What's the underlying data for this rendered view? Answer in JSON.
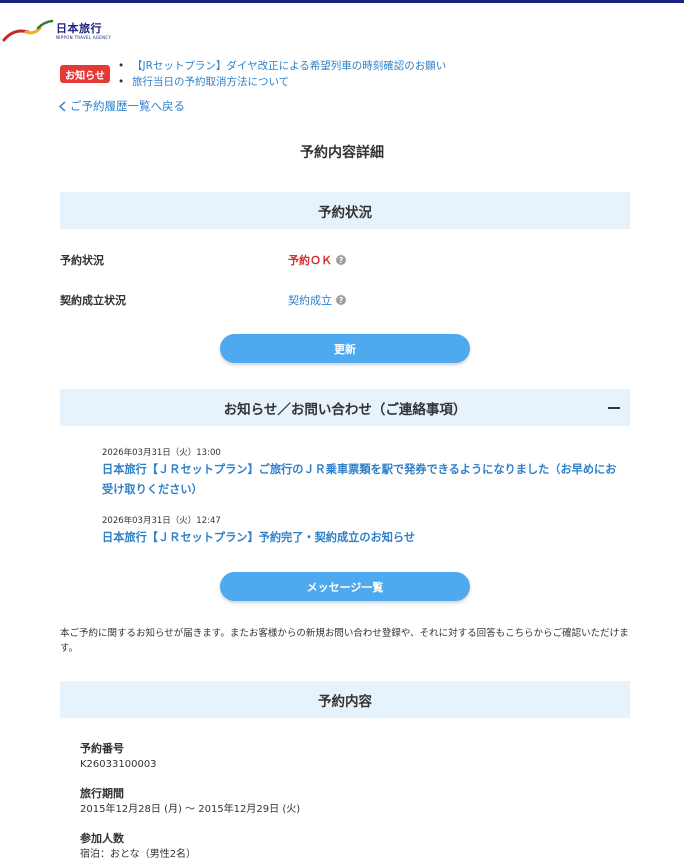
{
  "brand": {
    "name": "日本旅行",
    "sub": "NIPPON TRAVEL AGENCY",
    "colors": {
      "navy": "#1a237e",
      "red": "#c62828",
      "yellow": "#f9a825",
      "green": "#2e7d32"
    }
  },
  "notice": {
    "badge": "お知らせ",
    "items": [
      "【JRセットプラン】ダイヤ改正による希望列車の時刻確認のお願い",
      "旅行当日の予約取消方法について"
    ]
  },
  "nav": {
    "back_icon": "chevron-left-icon",
    "back_label": "ご予約履歴一覧へ戻る"
  },
  "page": {
    "title": "予約内容詳細"
  },
  "status_section": {
    "title": "予約状況",
    "rows": [
      {
        "label": "予約状況",
        "value": "予約ＯＫ",
        "help": "?"
      },
      {
        "label": "契約成立状況",
        "value": "契約成立",
        "help": "?"
      }
    ],
    "refresh_button": "更新"
  },
  "messages_section": {
    "title": "お知らせ／お問い合わせ（ご連絡事項）",
    "messages": [
      {
        "date": "2026年03月31日（火）13:00",
        "title": "日本旅行【ＪＲセットプラン】ご旅行のＪＲ乗車票類を駅で発券できるようになりました（お早めにお受け取りください）"
      },
      {
        "date": "2026年03月31日（火）12:47",
        "title": "日本旅行【ＪＲセットプラン】予約完了・契約成立のお知らせ"
      }
    ],
    "list_button": "メッセージ一覧",
    "description": "本ご予約に関するお知らせが届きます。またお客様からの新規お問い合わせ登録や、それに対する回答もこちらからご確認いただけます。"
  },
  "booking_section": {
    "title": "予約内容",
    "fields": [
      {
        "label": "予約番号",
        "value": "K26033100003"
      },
      {
        "label": "旅行期間",
        "value": "2015年12月28日 (月) 〜 2015年12月29日 (火)"
      },
      {
        "label": "参加人数",
        "value": "宿泊：おとな（男性2名）"
      }
    ]
  },
  "colors": {
    "link": "#2f80c9",
    "accent": "#4ea9ee",
    "section_bg": "#e6f3fc",
    "status_ok": "#d32f2f",
    "badge": "#e53935"
  }
}
